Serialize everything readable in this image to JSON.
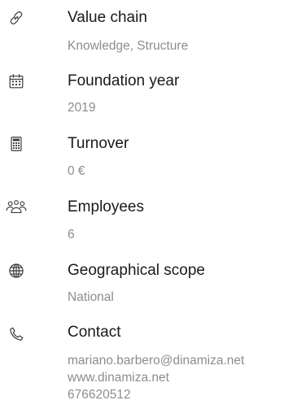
{
  "items": [
    {
      "icon": "link-icon",
      "title": "Value chain",
      "value": "Knowledge, Structure"
    },
    {
      "icon": "calendar-icon",
      "title": "Foundation year",
      "value": "2019"
    },
    {
      "icon": "calculator-icon",
      "title": "Turnover",
      "value": "0 €"
    },
    {
      "icon": "users-icon",
      "title": "Employees",
      "value": "6"
    },
    {
      "icon": "globe-icon",
      "title": "Geographical scope",
      "value": "National"
    },
    {
      "icon": "phone-icon",
      "title": "Contact",
      "lines": [
        "mariano.barbero@dinamiza.net",
        "www.dinamiza.net",
        "676620512"
      ]
    }
  ],
  "colors": {
    "title": "#1a1a1a",
    "value": "#8d8d8d",
    "icon": "#3a3a3a"
  }
}
